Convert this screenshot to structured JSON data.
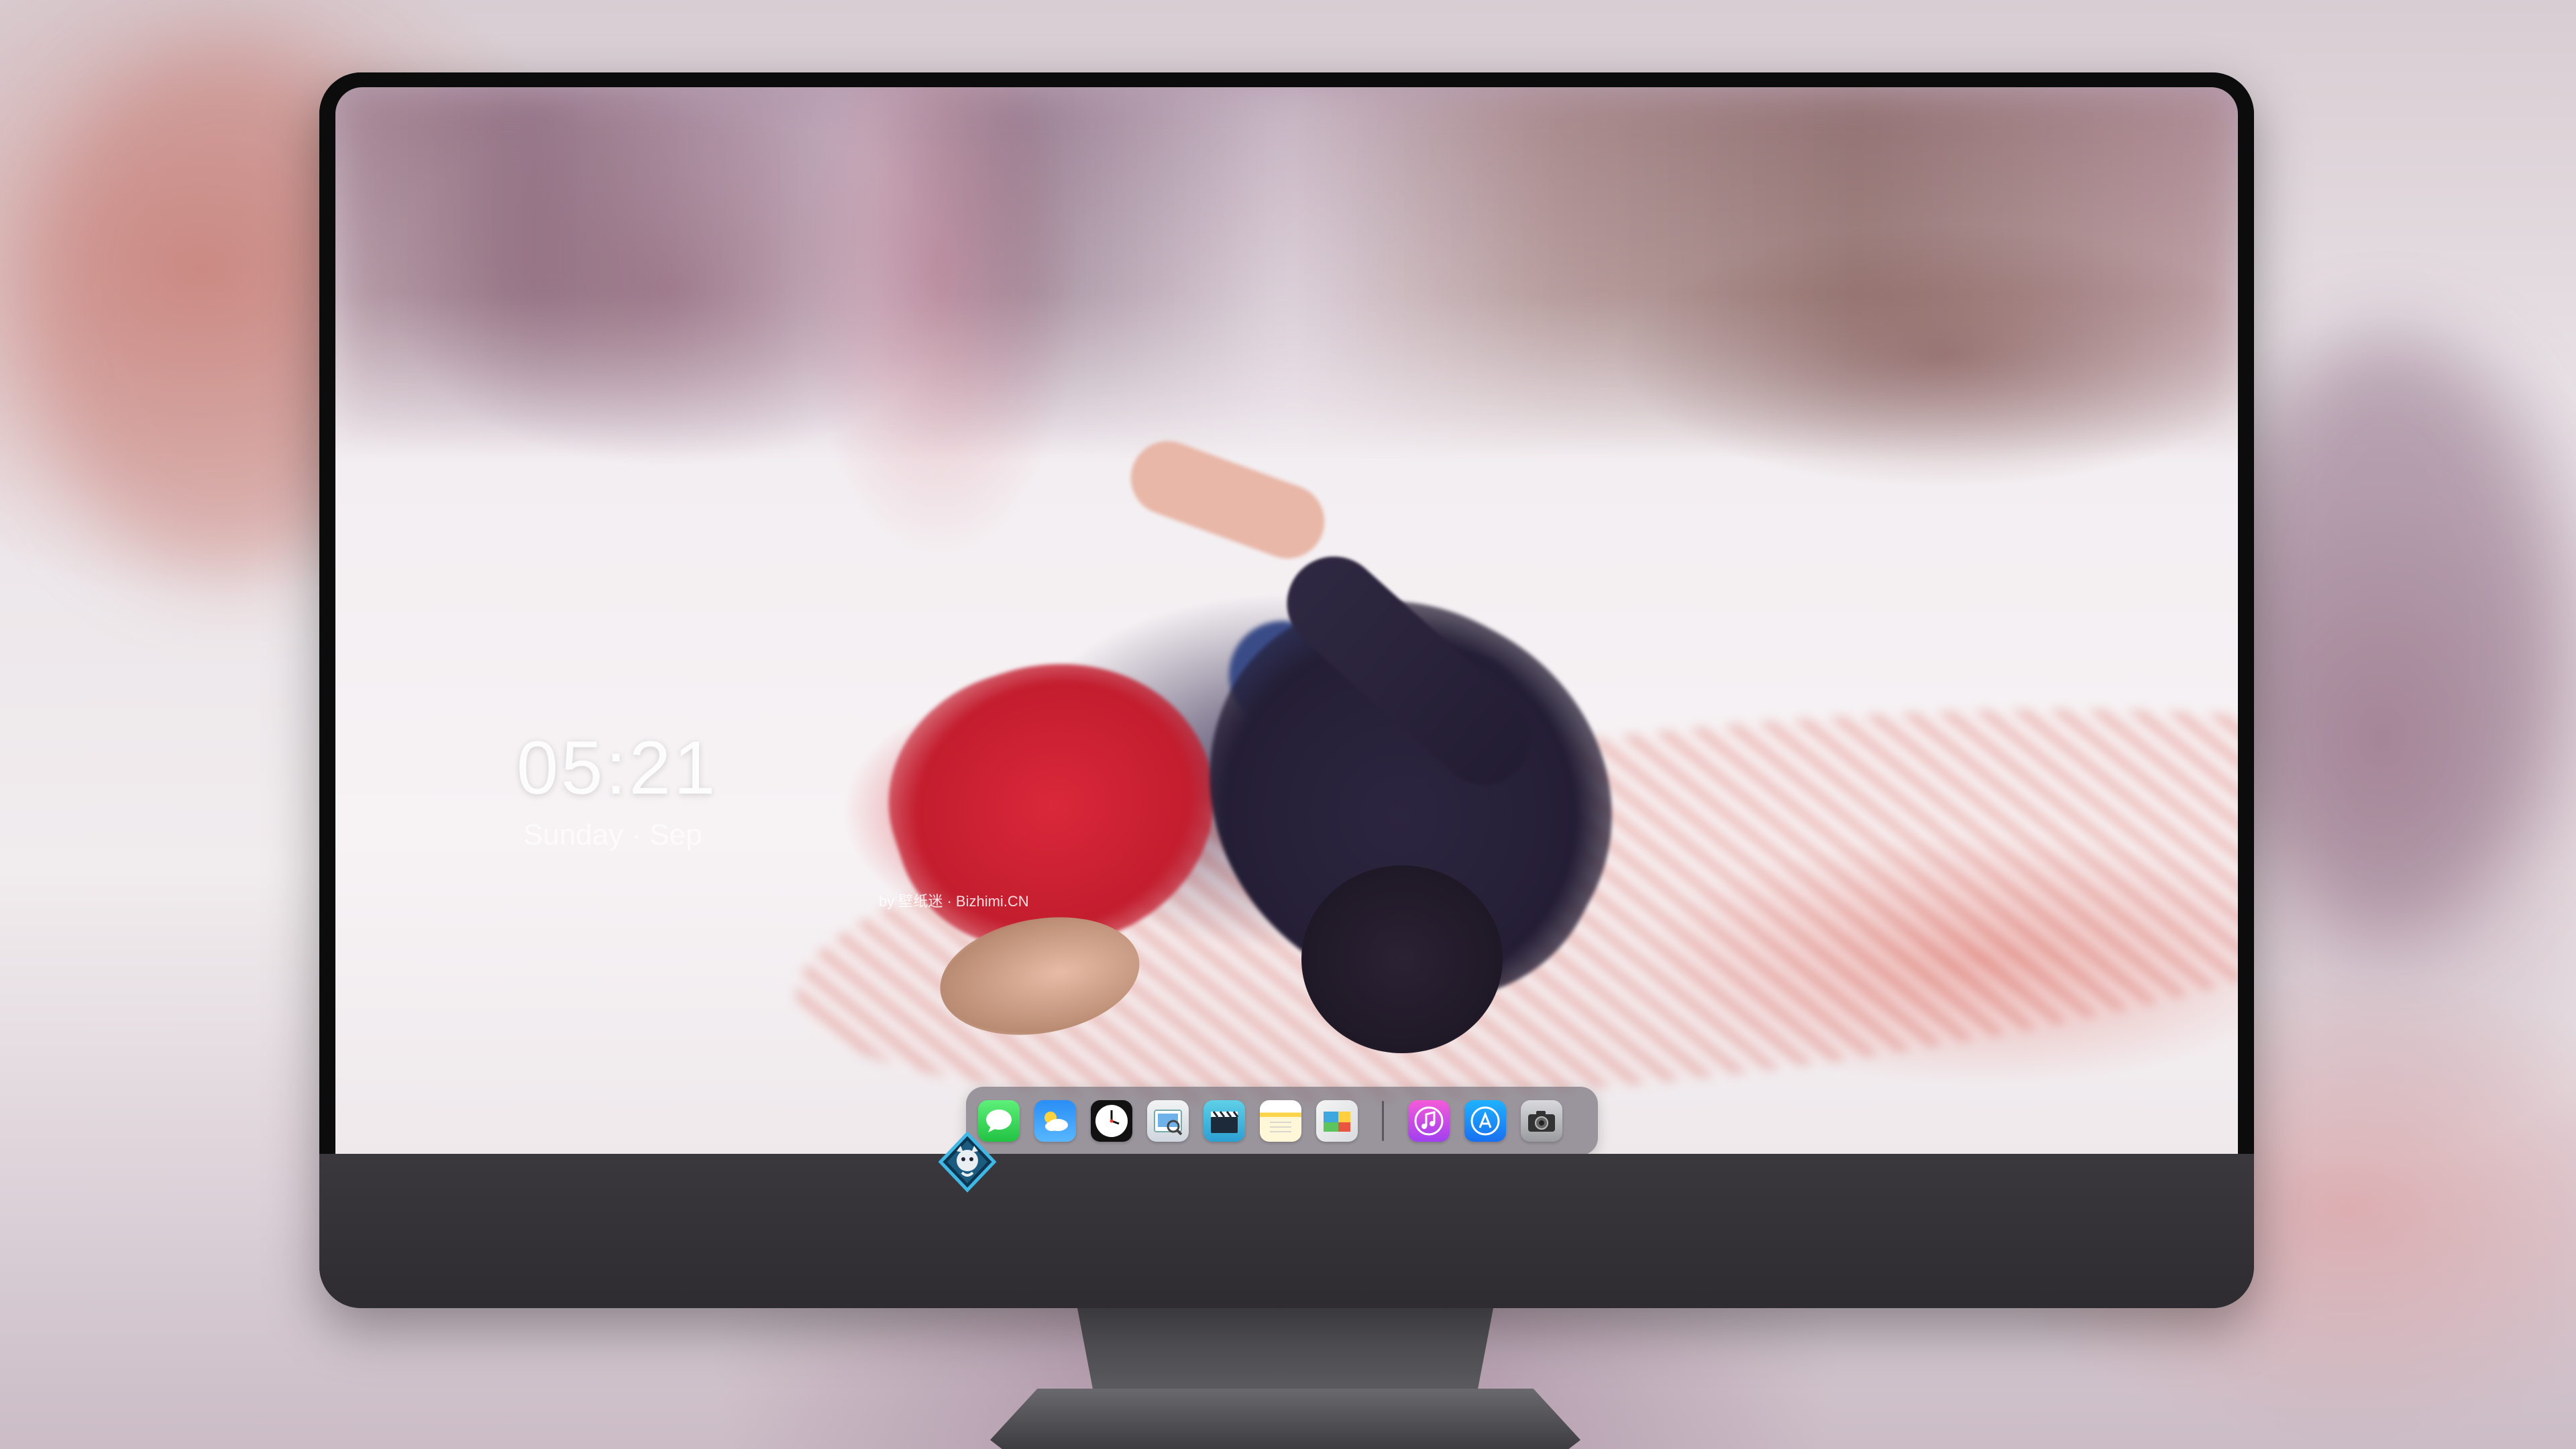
{
  "lockscreen": {
    "time": "05:21",
    "date": "Sunday · Sep",
    "credit": "by 壁纸迷 · Bizhimi.CN"
  },
  "dock": {
    "apps": [
      {
        "name": "messages",
        "icon": "message-bubble-icon",
        "glyph": "💬"
      },
      {
        "name": "weather",
        "icon": "cloud-sun-icon",
        "glyph": "⛅"
      },
      {
        "name": "clock",
        "icon": "clock-icon",
        "glyph": "🕐"
      },
      {
        "name": "preview",
        "icon": "preview-icon",
        "glyph": "🖼"
      },
      {
        "name": "video",
        "icon": "clapperboard-icon",
        "glyph": "🎬"
      },
      {
        "name": "notes",
        "icon": "notes-icon",
        "glyph": ""
      },
      {
        "name": "photos",
        "icon": "photos-icon",
        "glyph": "🏞"
      }
    ],
    "apps_right": [
      {
        "name": "music",
        "icon": "music-note-icon",
        "glyph": "♫"
      },
      {
        "name": "app-store",
        "icon": "app-store-icon",
        "glyph": "Ⓐ"
      },
      {
        "name": "camera",
        "icon": "camera-icon",
        "glyph": "📷"
      }
    ]
  },
  "colors": {
    "accent_red": "#d9283a",
    "dock_bg": "#78737d",
    "bezel": "#0c0c0d",
    "chin": "#2e2c30"
  }
}
